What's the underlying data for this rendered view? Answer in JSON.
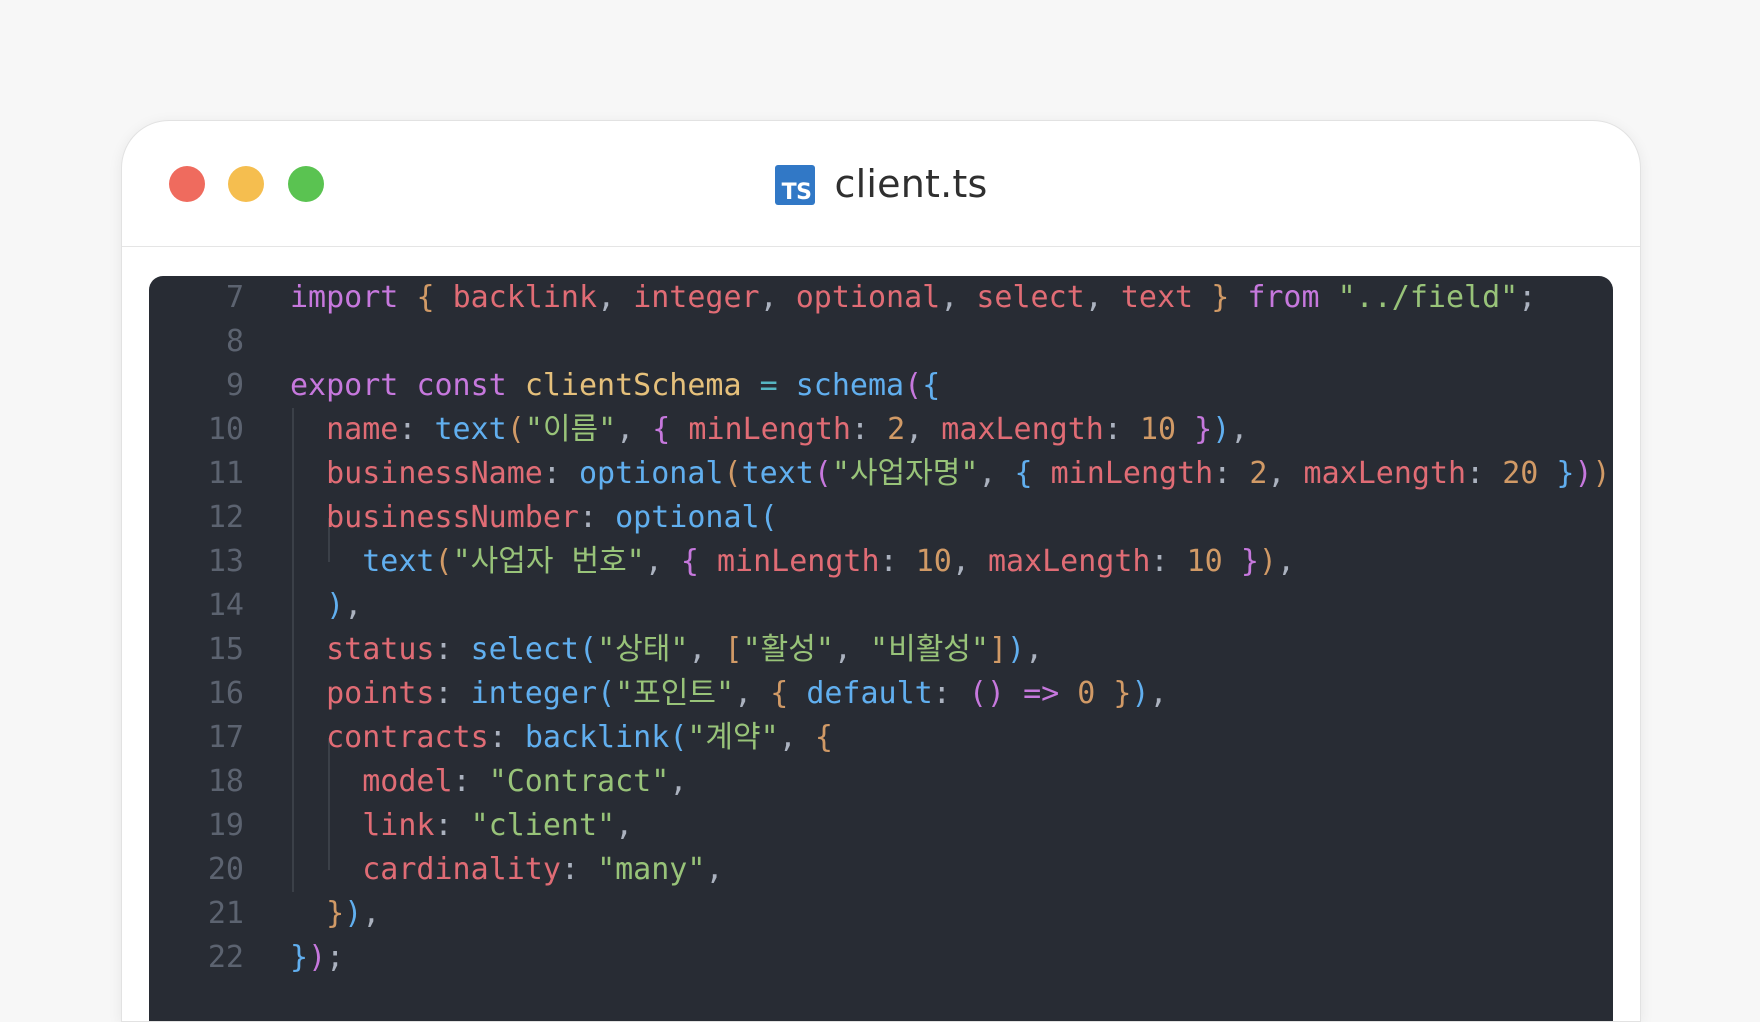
{
  "window": {
    "title": "client.ts",
    "file_icon_label": "TS",
    "colors": {
      "close": "#ef6b5e",
      "minimize": "#f5be4f",
      "zoom": "#5ac351",
      "ts_icon": "#3178c6",
      "editor_bg": "#282c34"
    }
  },
  "editor": {
    "lines": [
      {
        "number": "7",
        "tokens": [
          {
            "t": "import",
            "c": "kw"
          },
          {
            "t": " ",
            "c": "pu"
          },
          {
            "t": "{",
            "c": "b1"
          },
          {
            "t": " ",
            "c": "pu"
          },
          {
            "t": "backlink",
            "c": "id"
          },
          {
            "t": ", ",
            "c": "pu"
          },
          {
            "t": "integer",
            "c": "id"
          },
          {
            "t": ", ",
            "c": "pu"
          },
          {
            "t": "optional",
            "c": "id"
          },
          {
            "t": ", ",
            "c": "pu"
          },
          {
            "t": "select",
            "c": "id"
          },
          {
            "t": ", ",
            "c": "pu"
          },
          {
            "t": "text",
            "c": "id"
          },
          {
            "t": " ",
            "c": "pu"
          },
          {
            "t": "}",
            "c": "b1"
          },
          {
            "t": " ",
            "c": "pu"
          },
          {
            "t": "from",
            "c": "kw"
          },
          {
            "t": " ",
            "c": "pu"
          },
          {
            "t": "\"../field\"",
            "c": "st"
          },
          {
            "t": ";",
            "c": "pu"
          }
        ]
      },
      {
        "number": "8",
        "tokens": []
      },
      {
        "number": "9",
        "tokens": [
          {
            "t": "export",
            "c": "kw"
          },
          {
            "t": " ",
            "c": "pu"
          },
          {
            "t": "const",
            "c": "kw"
          },
          {
            "t": " ",
            "c": "pu"
          },
          {
            "t": "clientSchema",
            "c": "cl"
          },
          {
            "t": " ",
            "c": "pu"
          },
          {
            "t": "=",
            "c": "op"
          },
          {
            "t": " ",
            "c": "pu"
          },
          {
            "t": "schema",
            "c": "fn"
          },
          {
            "t": "(",
            "c": "b2"
          },
          {
            "t": "{",
            "c": "b3"
          }
        ]
      },
      {
        "number": "10",
        "tokens": [
          {
            "t": "  ",
            "c": "pu"
          },
          {
            "t": "name",
            "c": "pr"
          },
          {
            "t": ": ",
            "c": "pu"
          },
          {
            "t": "text",
            "c": "fn"
          },
          {
            "t": "(",
            "c": "b1"
          },
          {
            "t": "\"이름\"",
            "c": "st"
          },
          {
            "t": ", ",
            "c": "pu"
          },
          {
            "t": "{",
            "c": "b2"
          },
          {
            "t": " ",
            "c": "pu"
          },
          {
            "t": "minLength",
            "c": "pr"
          },
          {
            "t": ": ",
            "c": "pu"
          },
          {
            "t": "2",
            "c": "nu"
          },
          {
            "t": ", ",
            "c": "pu"
          },
          {
            "t": "maxLength",
            "c": "pr"
          },
          {
            "t": ": ",
            "c": "pu"
          },
          {
            "t": "10",
            "c": "nu"
          },
          {
            "t": " ",
            "c": "pu"
          },
          {
            "t": "}",
            "c": "b2"
          },
          {
            "t": ")",
            "c": "b3"
          },
          {
            "t": ",",
            "c": "pu"
          }
        ]
      },
      {
        "number": "11",
        "tokens": [
          {
            "t": "  ",
            "c": "pu"
          },
          {
            "t": "businessName",
            "c": "pr"
          },
          {
            "t": ": ",
            "c": "pu"
          },
          {
            "t": "optional",
            "c": "fn"
          },
          {
            "t": "(",
            "c": "b1"
          },
          {
            "t": "text",
            "c": "fn"
          },
          {
            "t": "(",
            "c": "b2"
          },
          {
            "t": "\"사업자명\"",
            "c": "st"
          },
          {
            "t": ", ",
            "c": "pu"
          },
          {
            "t": "{",
            "c": "b3"
          },
          {
            "t": " ",
            "c": "pu"
          },
          {
            "t": "minLength",
            "c": "pr"
          },
          {
            "t": ": ",
            "c": "pu"
          },
          {
            "t": "2",
            "c": "nu"
          },
          {
            "t": ", ",
            "c": "pu"
          },
          {
            "t": "maxLength",
            "c": "pr"
          },
          {
            "t": ": ",
            "c": "pu"
          },
          {
            "t": "20",
            "c": "nu"
          },
          {
            "t": " ",
            "c": "pu"
          },
          {
            "t": "}",
            "c": "b3"
          },
          {
            "t": ")",
            "c": "b2"
          },
          {
            "t": ")",
            "c": "b1"
          },
          {
            "t": ",",
            "c": "pu"
          }
        ]
      },
      {
        "number": "12",
        "tokens": [
          {
            "t": "  ",
            "c": "pu"
          },
          {
            "t": "businessNumber",
            "c": "pr"
          },
          {
            "t": ": ",
            "c": "pu"
          },
          {
            "t": "optional",
            "c": "fn"
          },
          {
            "t": "(",
            "c": "b3"
          }
        ]
      },
      {
        "number": "13",
        "tokens": [
          {
            "t": "    ",
            "c": "pu"
          },
          {
            "t": "text",
            "c": "fn"
          },
          {
            "t": "(",
            "c": "b1"
          },
          {
            "t": "\"사업자 번호\"",
            "c": "st"
          },
          {
            "t": ", ",
            "c": "pu"
          },
          {
            "t": "{",
            "c": "b2"
          },
          {
            "t": " ",
            "c": "pu"
          },
          {
            "t": "minLength",
            "c": "pr"
          },
          {
            "t": ": ",
            "c": "pu"
          },
          {
            "t": "10",
            "c": "nu"
          },
          {
            "t": ", ",
            "c": "pu"
          },
          {
            "t": "maxLength",
            "c": "pr"
          },
          {
            "t": ": ",
            "c": "pu"
          },
          {
            "t": "10",
            "c": "nu"
          },
          {
            "t": " ",
            "c": "pu"
          },
          {
            "t": "}",
            "c": "b2"
          },
          {
            "t": ")",
            "c": "b1"
          },
          {
            "t": ",",
            "c": "pu"
          }
        ]
      },
      {
        "number": "14",
        "tokens": [
          {
            "t": "  ",
            "c": "pu"
          },
          {
            "t": ")",
            "c": "b3"
          },
          {
            "t": ",",
            "c": "pu"
          }
        ]
      },
      {
        "number": "15",
        "tokens": [
          {
            "t": "  ",
            "c": "pu"
          },
          {
            "t": "status",
            "c": "pr"
          },
          {
            "t": ": ",
            "c": "pu"
          },
          {
            "t": "select",
            "c": "fn"
          },
          {
            "t": "(",
            "c": "b3"
          },
          {
            "t": "\"상태\"",
            "c": "st"
          },
          {
            "t": ", ",
            "c": "pu"
          },
          {
            "t": "[",
            "c": "b1"
          },
          {
            "t": "\"활성\"",
            "c": "st"
          },
          {
            "t": ", ",
            "c": "pu"
          },
          {
            "t": "\"비활성\"",
            "c": "st"
          },
          {
            "t": "]",
            "c": "b1"
          },
          {
            "t": ")",
            "c": "b3"
          },
          {
            "t": ",",
            "c": "pu"
          }
        ]
      },
      {
        "number": "16",
        "tokens": [
          {
            "t": "  ",
            "c": "pu"
          },
          {
            "t": "points",
            "c": "pr"
          },
          {
            "t": ": ",
            "c": "pu"
          },
          {
            "t": "integer",
            "c": "fn"
          },
          {
            "t": "(",
            "c": "b3"
          },
          {
            "t": "\"포인트\"",
            "c": "st"
          },
          {
            "t": ", ",
            "c": "pu"
          },
          {
            "t": "{",
            "c": "b1"
          },
          {
            "t": " ",
            "c": "pu"
          },
          {
            "t": "default",
            "c": "fn"
          },
          {
            "t": ": ",
            "c": "pu"
          },
          {
            "t": "()",
            "c": "b2"
          },
          {
            "t": " ",
            "c": "pu"
          },
          {
            "t": "=>",
            "c": "kw"
          },
          {
            "t": " ",
            "c": "pu"
          },
          {
            "t": "0",
            "c": "nu"
          },
          {
            "t": " ",
            "c": "pu"
          },
          {
            "t": "}",
            "c": "b1"
          },
          {
            "t": ")",
            "c": "b3"
          },
          {
            "t": ",",
            "c": "pu"
          }
        ]
      },
      {
        "number": "17",
        "tokens": [
          {
            "t": "  ",
            "c": "pu"
          },
          {
            "t": "contracts",
            "c": "pr"
          },
          {
            "t": ": ",
            "c": "pu"
          },
          {
            "t": "backlink",
            "c": "fn"
          },
          {
            "t": "(",
            "c": "b3"
          },
          {
            "t": "\"계약\"",
            "c": "st"
          },
          {
            "t": ", ",
            "c": "pu"
          },
          {
            "t": "{",
            "c": "b1"
          }
        ]
      },
      {
        "number": "18",
        "tokens": [
          {
            "t": "    ",
            "c": "pu"
          },
          {
            "t": "model",
            "c": "pr"
          },
          {
            "t": ": ",
            "c": "pu"
          },
          {
            "t": "\"Contract\"",
            "c": "st"
          },
          {
            "t": ",",
            "c": "pu"
          }
        ]
      },
      {
        "number": "19",
        "tokens": [
          {
            "t": "    ",
            "c": "pu"
          },
          {
            "t": "link",
            "c": "pr"
          },
          {
            "t": ": ",
            "c": "pu"
          },
          {
            "t": "\"client\"",
            "c": "st"
          },
          {
            "t": ",",
            "c": "pu"
          }
        ]
      },
      {
        "number": "20",
        "tokens": [
          {
            "t": "    ",
            "c": "pu"
          },
          {
            "t": "cardinality",
            "c": "pr"
          },
          {
            "t": ": ",
            "c": "pu"
          },
          {
            "t": "\"many\"",
            "c": "st"
          },
          {
            "t": ",",
            "c": "pu"
          }
        ]
      },
      {
        "number": "21",
        "tokens": [
          {
            "t": "  ",
            "c": "pu"
          },
          {
            "t": "}",
            "c": "b1"
          },
          {
            "t": ")",
            "c": "b3"
          },
          {
            "t": ",",
            "c": "pu"
          }
        ]
      },
      {
        "number": "22",
        "tokens": [
          {
            "t": "}",
            "c": "b3"
          },
          {
            "t": ")",
            "c": "b2"
          },
          {
            "t": ";",
            "c": "pu"
          }
        ]
      }
    ]
  }
}
